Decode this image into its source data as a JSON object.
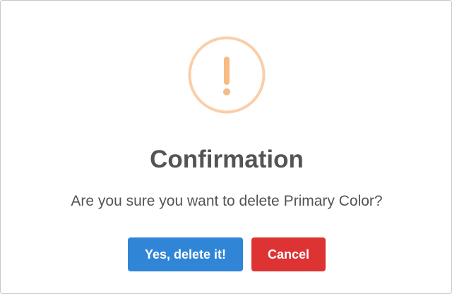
{
  "dialog": {
    "icon": "exclamation-icon",
    "icon_color": "#f8bb86",
    "icon_ring_color": "#facea8",
    "title": "Confirmation",
    "message": "Are you sure you want to delete Primary Color?",
    "confirm_button": {
      "label": "Yes, delete it!",
      "color": "#3085d6"
    },
    "cancel_button": {
      "label": "Cancel",
      "color": "#dd3333"
    }
  }
}
